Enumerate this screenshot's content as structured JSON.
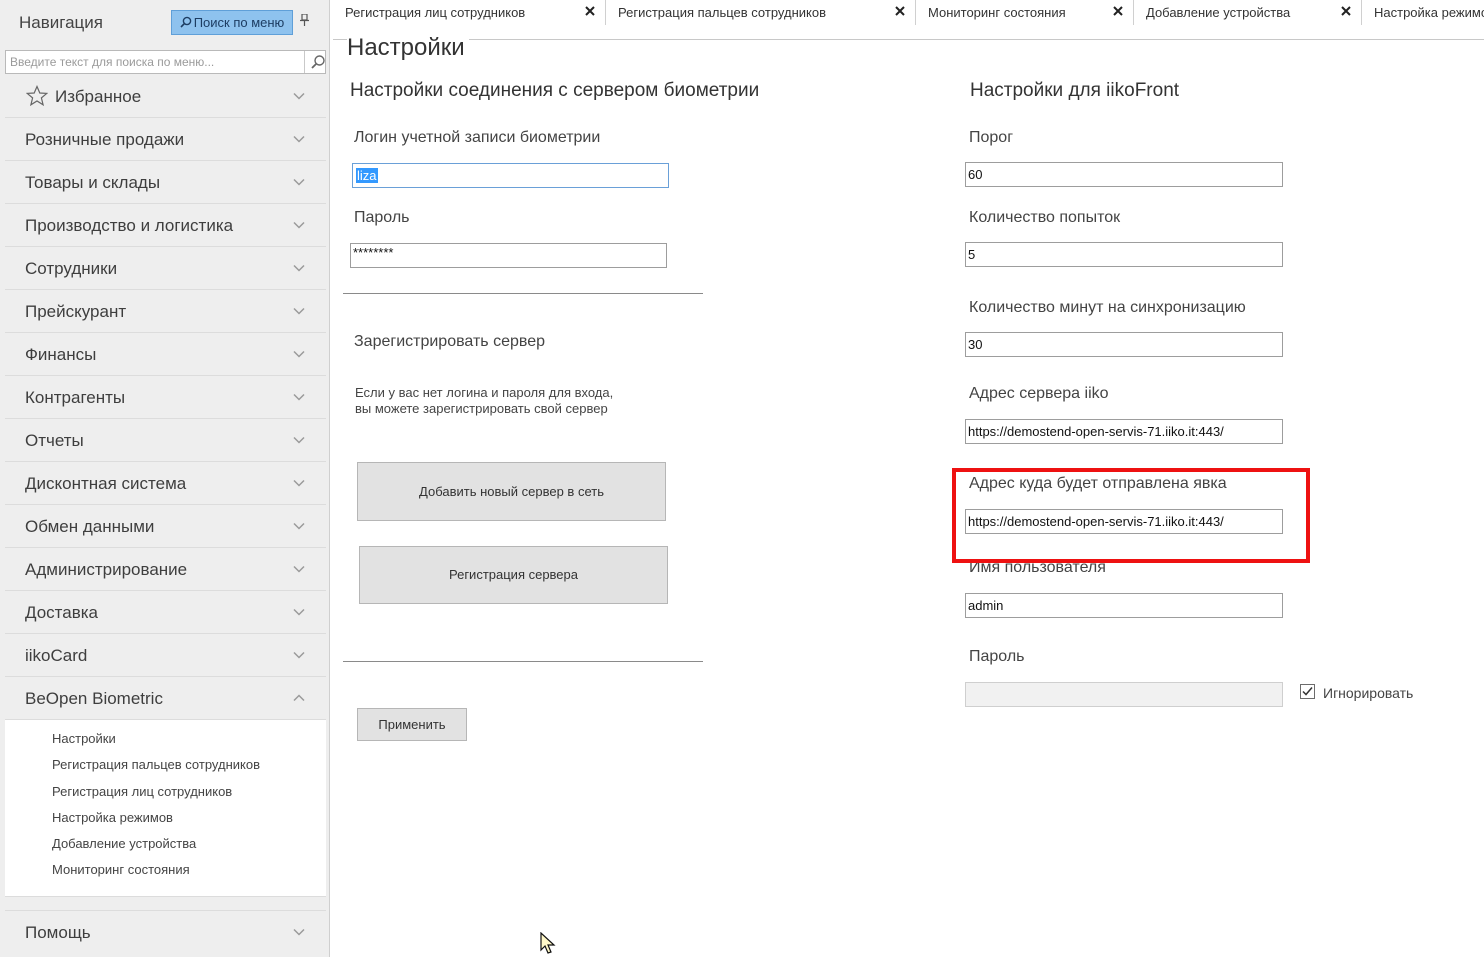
{
  "colors": {
    "highlight_box": "#ee1111",
    "search_button_bg": "#8ec2ee",
    "sidebar_bg": "#eeeeee",
    "selection": "#3399ff"
  },
  "sidebar": {
    "title": "Навигация",
    "search_button": "Поиск по меню",
    "search_placeholder": "Введите текст для поиска по меню...",
    "favorites": "Избранное",
    "items": [
      "Розничные продажи",
      "Товары и склады",
      "Производство и логистика",
      "Сотрудники",
      "Прейскурант",
      "Финансы",
      "Контрагенты",
      "Отчеты",
      "Дисконтная система",
      "Обмен данными",
      "Администрирование",
      "Доставка",
      "iikoCard"
    ],
    "expanded_item": "BeOpen Biometric",
    "sub_items": [
      "Настройки",
      "Регистрация пальцев сотрудников",
      "Регистрация лиц сотрудников",
      "Настройка режимов",
      "Добавление устройства",
      "Мониторинг состояния"
    ],
    "help": "Помощь"
  },
  "tabs": [
    "Регистрация лиц сотрудников",
    "Регистрация пальцев сотрудников",
    "Мониторинг состояния",
    "Добавление устройства",
    "Настройка режимов"
  ],
  "page_title": "Настройки",
  "left": {
    "section_title": "Настройки соединения с сервером биометрии",
    "login_label": "Логин учетной записи биометрии",
    "login_value": "liza",
    "password_label": "Пароль",
    "password_value": "********",
    "register_title": "Зарегистрировать сервер",
    "register_note_line1": "Если у вас нет логина и пароля для входа,",
    "register_note_line2": "вы можете зарегистрировать свой сервер",
    "add_server_button": "Добавить новый сервер в сеть",
    "register_server_button": "Регистрация сервера",
    "apply_button": "Применить"
  },
  "right": {
    "section_title": "Настройки для iikoFront",
    "threshold_label": "Порог",
    "threshold_value": "60",
    "attempts_label": "Количество попыток",
    "attempts_value": "5",
    "sync_minutes_label": "Количество минут на синхронизацию",
    "sync_minutes_value": "30",
    "server_address_label": "Адрес сервера iiko",
    "server_address_value": "https://demostend-open-servis-71.iiko.it:443/",
    "attendance_address_label": "Адрес куда будет отправлена явка",
    "attendance_address_value": "https://demostend-open-servis-71.iiko.it:443/",
    "username_label": "Имя пользователя",
    "username_value": "admin",
    "password_label": "Пароль",
    "password_value": "",
    "ignore_label": "Игнорировать",
    "ignore_checked": true
  }
}
